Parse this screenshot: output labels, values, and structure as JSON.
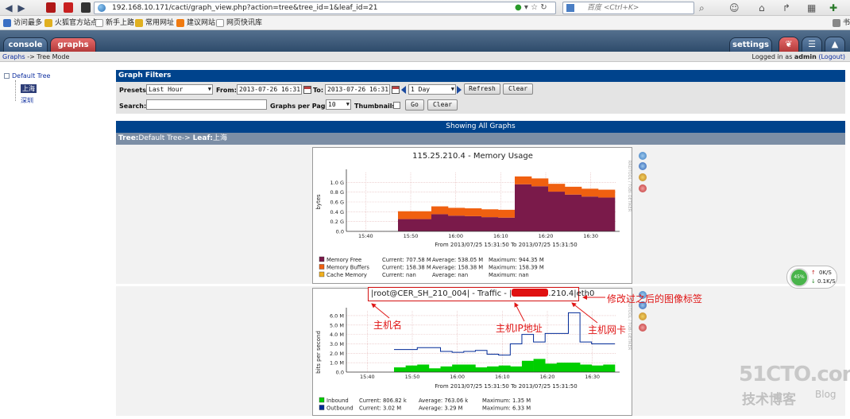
{
  "browser": {
    "url": "192.168.10.171/cacti/graph_view.php?action=tree&tree_id=1&leaf_id=21",
    "search_placeholder": "百度 <Ctrl+K>"
  },
  "bookmarks": [
    "访问最多",
    "火狐官方站点",
    "新手上路",
    "常用网址",
    "建议网站",
    "网页快讯库"
  ],
  "bookmarks_overflow": "书",
  "header": {
    "tab_console": "console",
    "tab_graphs": "graphs",
    "tab_settings": "settings"
  },
  "breadcrumb": {
    "link": "Graphs",
    "separator": " -> ",
    "current": "Tree Mode"
  },
  "login": {
    "prefix": "Logged in as ",
    "user": "admin",
    "logout": "(Logout)"
  },
  "tree": {
    "root": "Default Tree",
    "leaf_selected": "上海",
    "leaf_other": "深圳"
  },
  "filters": {
    "title": "Graph Filters",
    "presets_label": "Presets:",
    "presets_value": "Last Hour",
    "from_label": "From:",
    "from_value": "2013-07-26 16:31",
    "to_label": "To:",
    "to_value": "2013-07-26 16:31",
    "span_value": "1 Day",
    "refresh": "Refresh",
    "clear": "Clear",
    "search_label": "Search:",
    "search_value": "",
    "per_page_label": "Graphs per Page:",
    "per_page_value": "10",
    "thumbnails_label": "Thumbnails:",
    "go": "Go",
    "clear2": "Clear"
  },
  "showing_all": "Showing All Graphs",
  "tree_path": {
    "tree_label": "Tree:",
    "tree_value": "Default Tree",
    "arrow": "-> ",
    "leaf_label": "Leaf:",
    "leaf_value": "上海"
  },
  "graph1": {
    "title": "115.25.210.4 - Memory Usage",
    "ylabel": "bytes",
    "side_label": "RRDTOOL / TOBI OETIKER",
    "range_text": "From 2013/07/25 15:31:50 To 2013/07/25 15:31:50",
    "legend": [
      {
        "name": "Memory Free",
        "current": "Current:  707.58 M",
        "average": "Average:  538.05 M",
        "maximum": "Maximum:  944.35 M",
        "color": "#7a1a4a"
      },
      {
        "name": "Memory Buffers",
        "current": "Current:  158.38 M",
        "average": "Average:  158.38 M",
        "maximum": "Maximum:  158.39 M",
        "color": "#f06010"
      },
      {
        "name": "Cache Memory",
        "current": "Current:      nan",
        "average": "Average:      nan",
        "maximum": "Maximum:      nan",
        "color": "#f0b020"
      }
    ]
  },
  "graph2": {
    "title_prefix": "|root@CER_SH_210_004| - Traffic - |",
    "title_suffix": ".210.4|eth0",
    "ylabel": "bits per second",
    "side_label": "RRDTOOL / TOBI OETIKER",
    "range_text": "From 2013/07/25 15:31:50 To 2013/07/25 15:31:50",
    "legend": [
      {
        "name": "Inbound",
        "current": "Current:  806.82 k",
        "average": "Average:  763.06 k",
        "maximum": "Maximum:    1.35 M",
        "color": "#00cf00"
      },
      {
        "name": "Outbound",
        "current": "Current:    3.02 M",
        "average": "Average:    3.29 M",
        "maximum": "Maximum:    6.33 M",
        "color": "#002a97"
      }
    ]
  },
  "annotations": {
    "label_tag": "修改过之后的图像标签",
    "hostname": "主机名",
    "host_ip": "主机IP地址",
    "host_nic": "主机网卡"
  },
  "speed_widget": {
    "percent": "45%",
    "up": "0K/S",
    "down": "0.1K/S"
  },
  "watermark": {
    "site": "51CTO.com",
    "sub": "技术博客",
    "blog": "Blog"
  },
  "chart_data": [
    {
      "type": "area",
      "title": "115.25.210.4 - Memory Usage",
      "ylabel": "bytes",
      "ylim": [
        0,
        1.2
      ],
      "y_ticks": [
        "0.0",
        "0.2 G",
        "0.4 G",
        "0.6 G",
        "0.8 G",
        "1.0 G"
      ],
      "x_ticks": [
        "15:40",
        "15:50",
        "16:00",
        "16:10",
        "16:20",
        "16:30"
      ],
      "series": [
        {
          "name": "Memory Free",
          "values": [
            0.25,
            0.25,
            0.35,
            0.32,
            0.31,
            0.29,
            0.28,
            0.96,
            0.92,
            0.81,
            0.75,
            0.71,
            0.69
          ]
        },
        {
          "name": "Memory Buffers",
          "values": [
            0.16,
            0.16,
            0.16,
            0.16,
            0.16,
            0.16,
            0.16,
            0.16,
            0.16,
            0.16,
            0.16,
            0.16,
            0.16
          ]
        },
        {
          "name": "Cache Memory",
          "values": [
            0,
            0,
            0,
            0,
            0,
            0,
            0,
            0,
            0,
            0,
            0,
            0,
            0
          ]
        }
      ]
    },
    {
      "type": "area",
      "title": "|root@CER_SH_210_004| - Traffic - |210.4|eth0",
      "ylabel": "bits per second",
      "ylim": [
        0,
        6.5
      ],
      "y_ticks": [
        "0.0",
        "1.0 M",
        "2.0 M",
        "3.0 M",
        "4.0 M",
        "5.0 M",
        "6.0 M"
      ],
      "x_ticks": [
        "15:40",
        "15:50",
        "16:00",
        "16:10",
        "16:20",
        "16:30"
      ],
      "series": [
        {
          "name": "Inbound",
          "values": [
            0.5,
            0.7,
            0.8,
            0.4,
            0.6,
            0.8,
            0.8,
            0.5,
            0.6,
            0.7,
            0.6,
            1.2,
            1.4,
            0.9,
            1.0,
            1.0,
            0.8,
            0.7,
            0.8
          ]
        },
        {
          "name": "Outbound",
          "values": [
            2.4,
            2.4,
            2.6,
            2.6,
            2.2,
            2.1,
            2.2,
            2.3,
            1.9,
            1.8,
            3.0,
            4.0,
            3.2,
            4.1,
            4.1,
            6.3,
            3.2,
            3.0,
            3.0
          ]
        }
      ]
    }
  ]
}
